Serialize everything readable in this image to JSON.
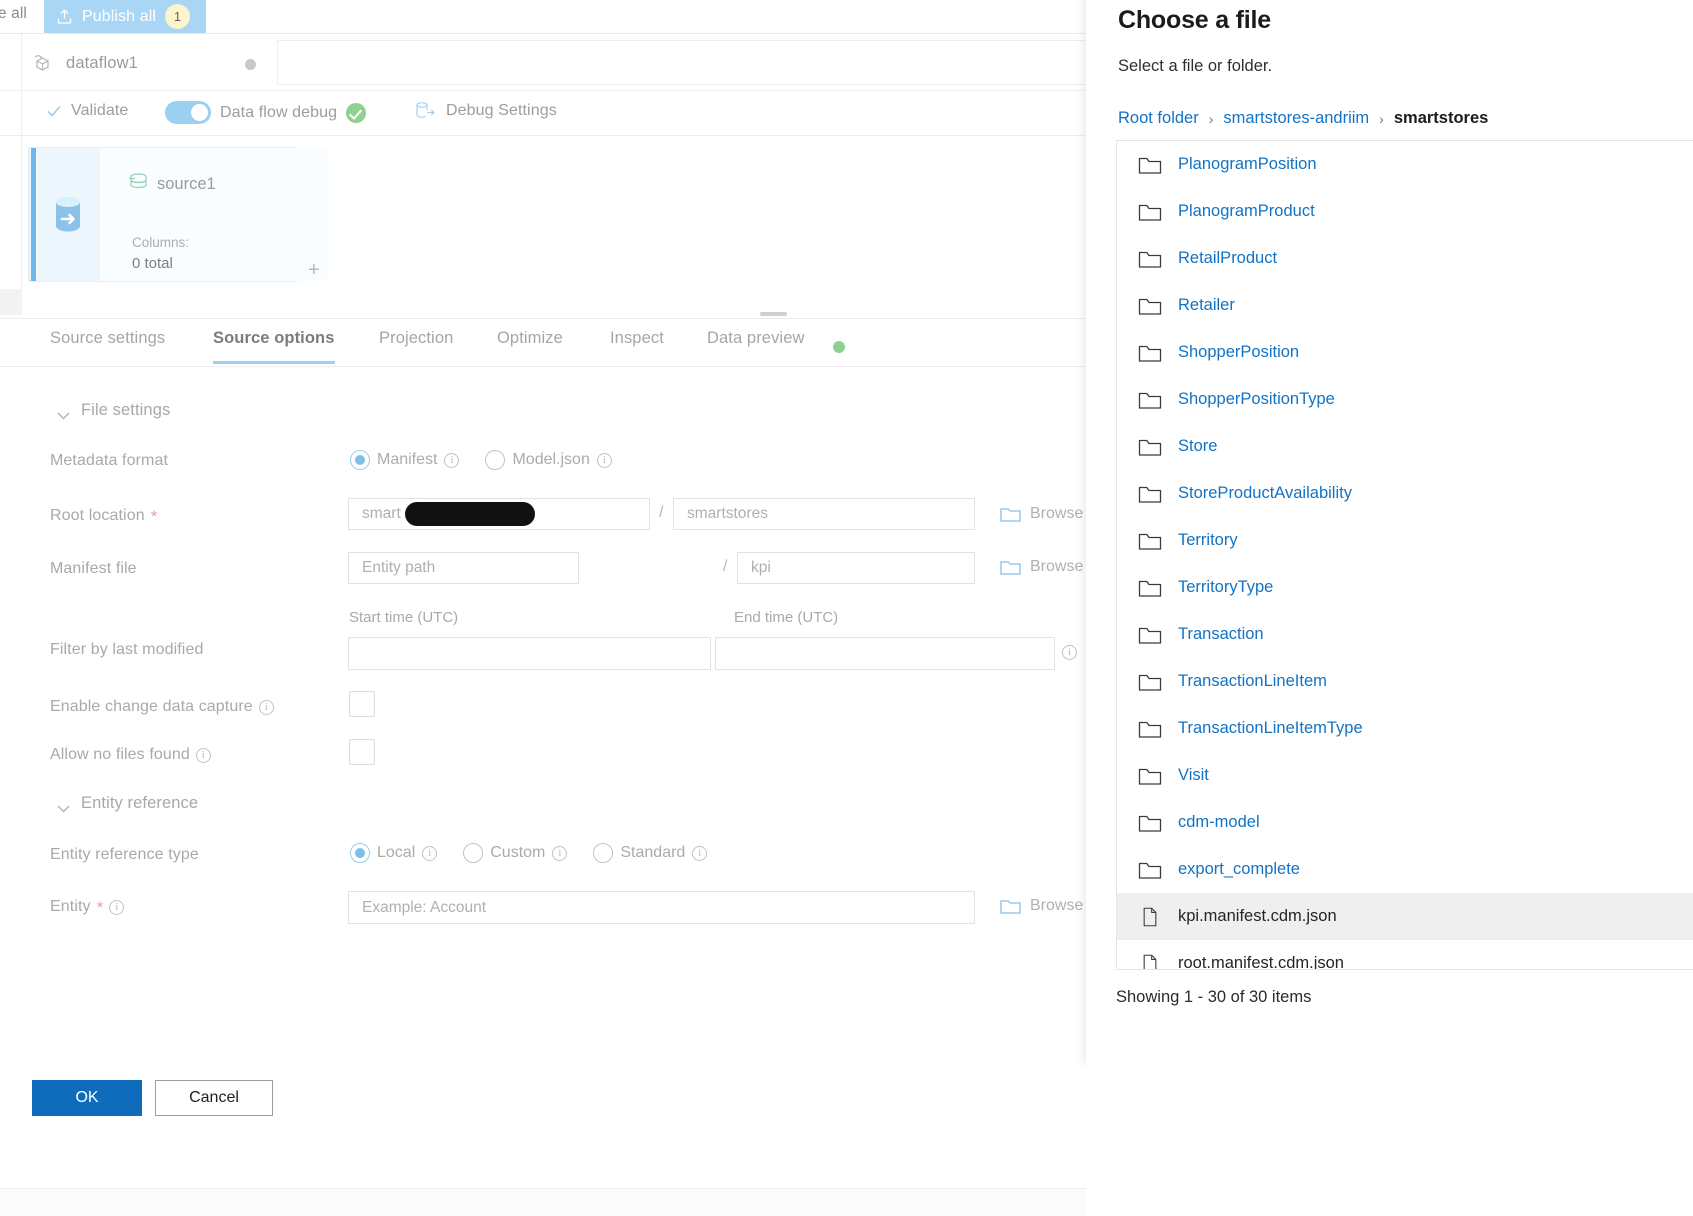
{
  "topbar": {
    "close_all_label": "e all",
    "publish_all_label": "Publish all",
    "publish_badge": "1",
    "publish_icon": "publish-upload-icon"
  },
  "dataflow": {
    "name": "dataflow1",
    "icon": "dataflow-icon",
    "status_dot": "unsaved-dot"
  },
  "toolbar": {
    "validate_label": "Validate",
    "validate_icon": "checkmark-icon",
    "debug_toggle_label": "Data flow debug",
    "debug_status_icon": "green-check-icon",
    "debug_settings_label": "Debug Settings",
    "debug_settings_icon": "database-arrow-icon"
  },
  "canvas": {
    "node": {
      "title": "source1",
      "title_icon": "database-stack-icon",
      "side_icon": "source-database-icon",
      "columns_label": "Columns:",
      "columns_value": "0 total",
      "add_label": "+"
    }
  },
  "tabs": [
    {
      "label": "Source settings",
      "active": false
    },
    {
      "label": "Source options",
      "active": true
    },
    {
      "label": "Projection",
      "active": false
    },
    {
      "label": "Optimize",
      "active": false
    },
    {
      "label": "Inspect",
      "active": false
    },
    {
      "label": "Data preview",
      "active": false
    }
  ],
  "form": {
    "file_settings_section": "File settings",
    "entity_reference_section": "Entity reference",
    "metadata_format": {
      "label": "Metadata format",
      "options": [
        {
          "label": "Manifest",
          "selected": true
        },
        {
          "label": "Model.json",
          "selected": false
        }
      ]
    },
    "root_location": {
      "label": "Root location",
      "required": true,
      "value_prefix": "smart",
      "value_redacted": true,
      "separator": "/",
      "second_value": "smartstores",
      "browse_label": "Browse"
    },
    "manifest_file": {
      "label": "Manifest file",
      "placeholder": "Entity path",
      "separator": "/",
      "second_value": "kpi",
      "browse_label": "Browse"
    },
    "filter_by_last_modified": {
      "label": "Filter by last modified",
      "start_label": "Start time (UTC)",
      "end_label": "End time (UTC)",
      "start_value": "",
      "end_value": ""
    },
    "enable_cdc": {
      "label": "Enable change data capture",
      "checked": false
    },
    "allow_no_files": {
      "label": "Allow no files found",
      "checked": false
    },
    "entity_reference_type": {
      "label": "Entity reference type",
      "options": [
        {
          "label": "Local",
          "selected": true
        },
        {
          "label": "Custom",
          "selected": false
        },
        {
          "label": "Standard",
          "selected": false
        }
      ]
    },
    "entity": {
      "label": "Entity",
      "required": true,
      "placeholder": "Example: Account",
      "browse_label": "Browse"
    }
  },
  "modal": {
    "title": "Choose a file",
    "subtitle": "Select a file or folder.",
    "breadcrumb": [
      {
        "label": "Root folder",
        "current": false
      },
      {
        "label": "smartstores-andriim",
        "current": false
      },
      {
        "label": "smartstores",
        "current": true
      }
    ],
    "breadcrumb_separator": "›",
    "items": [
      {
        "name": "PlanogramPosition",
        "type": "folder",
        "selected": false
      },
      {
        "name": "PlanogramProduct",
        "type": "folder",
        "selected": false
      },
      {
        "name": "RetailProduct",
        "type": "folder",
        "selected": false
      },
      {
        "name": "Retailer",
        "type": "folder",
        "selected": false
      },
      {
        "name": "ShopperPosition",
        "type": "folder",
        "selected": false
      },
      {
        "name": "ShopperPositionType",
        "type": "folder",
        "selected": false
      },
      {
        "name": "Store",
        "type": "folder",
        "selected": false
      },
      {
        "name": "StoreProductAvailability",
        "type": "folder",
        "selected": false
      },
      {
        "name": "Territory",
        "type": "folder",
        "selected": false
      },
      {
        "name": "TerritoryType",
        "type": "folder",
        "selected": false
      },
      {
        "name": "Transaction",
        "type": "folder",
        "selected": false
      },
      {
        "name": "TransactionLineItem",
        "type": "folder",
        "selected": false
      },
      {
        "name": "TransactionLineItemType",
        "type": "folder",
        "selected": false
      },
      {
        "name": "Visit",
        "type": "folder",
        "selected": false
      },
      {
        "name": "cdm-model",
        "type": "folder",
        "selected": false
      },
      {
        "name": "export_complete",
        "type": "folder",
        "selected": false
      },
      {
        "name": "kpi.manifest.cdm.json",
        "type": "file",
        "selected": true
      },
      {
        "name": "root.manifest.cdm.json",
        "type": "file",
        "selected": false
      }
    ],
    "showing_text": "Showing 1 - 30 of 30 items",
    "ok_label": "OK",
    "cancel_label": "Cancel"
  },
  "colors": {
    "accent_blue": "#0f6cbd",
    "link_blue": "#1273c4",
    "publish_bar": "#a9d6f5",
    "badge_yellow": "#fdf4cd",
    "toggle_on": "#9cd0f0",
    "tab_underline": "#9ed0ef",
    "success_green": "#8fd18f"
  }
}
